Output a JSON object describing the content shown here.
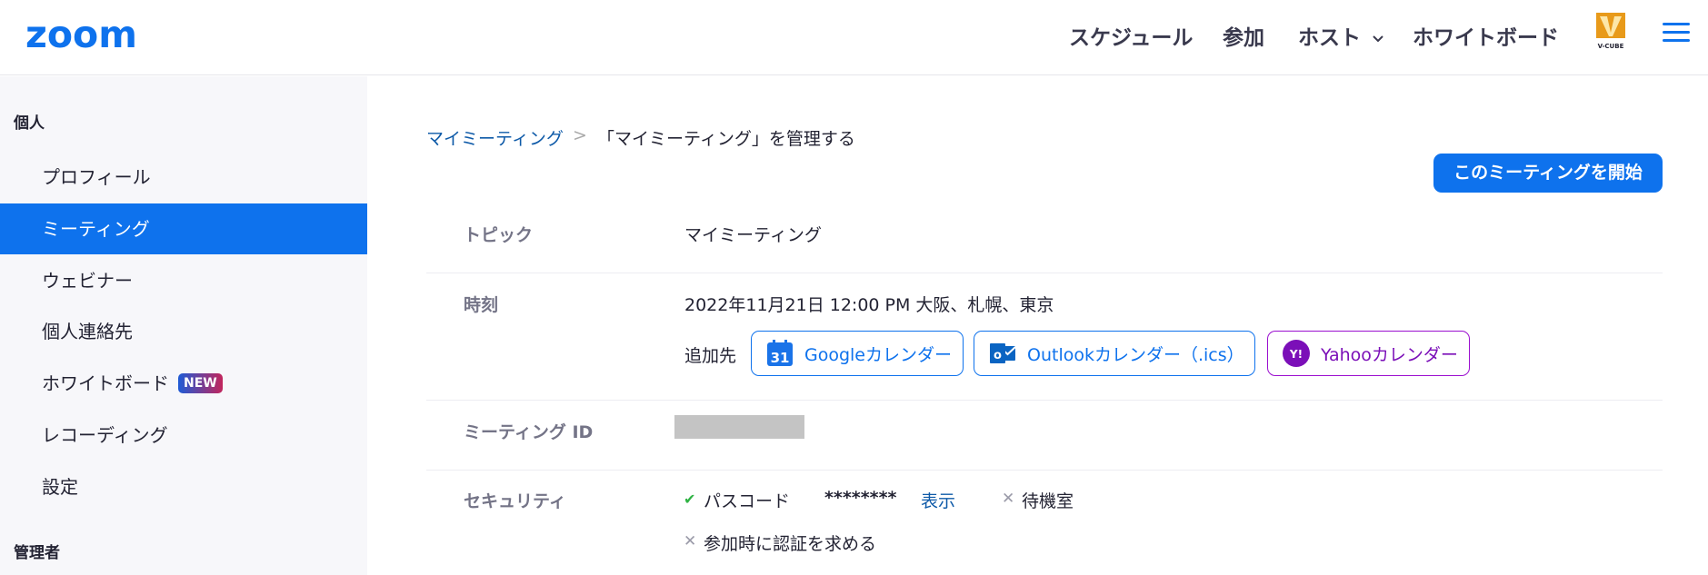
{
  "header": {
    "logo_text": "zoom",
    "nav": {
      "schedule": "スケジュール",
      "join": "参加",
      "host": "ホスト",
      "whiteboard": "ホワイトボード"
    },
    "brand_logo_text": "V-CUBE",
    "accent_color": "#0e72ed"
  },
  "sidebar": {
    "personal_heading": "個人",
    "items": [
      {
        "label": "プロフィール"
      },
      {
        "label": "ミーティング"
      },
      {
        "label": "ウェビナー"
      },
      {
        "label": "個人連絡先"
      },
      {
        "label": "ホワイトボード",
        "badge": "NEW"
      },
      {
        "label": "レコーディング"
      },
      {
        "label": "設定"
      }
    ],
    "admin_heading": "管理者",
    "active_index": 1
  },
  "breadcrumb": {
    "parent": "マイミーティング",
    "separator": ">",
    "current": "「マイミーティング」を管理する"
  },
  "start_button": "このミーティングを開始",
  "details": {
    "topic_label": "トピック",
    "topic_value": "マイミーティング",
    "time_label": "時刻",
    "time_value": "2022年11月21日 12:00 PM 大阪、札幌、東京",
    "add_to_label": "追加先",
    "calendars": {
      "google": "Googleカレンダー",
      "google_icon_text": "31",
      "outlook": "Outlookカレンダー（.ics）",
      "outlook_icon_text": "o",
      "yahoo": "Yahooカレンダー",
      "yahoo_icon_text": "Y!"
    },
    "meeting_id_label": "ミーティング ID",
    "security_label": "セキュリティ",
    "passcode_label": "パスコード",
    "passcode_value": "********",
    "show_link": "表示",
    "waiting_room": "待機室",
    "auth_required": "参加時に認証を求める"
  }
}
